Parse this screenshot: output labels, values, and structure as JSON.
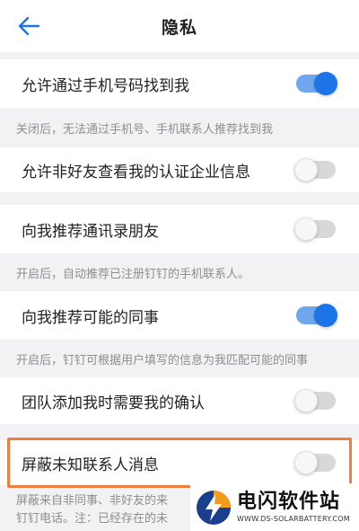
{
  "header": {
    "title": "隐私"
  },
  "settings": [
    {
      "label": "允许通过手机号码找到我",
      "on": true
    },
    {
      "label": "允许非好友查看我的认证企业信息",
      "on": false
    },
    {
      "label": "向我推荐通讯录朋友",
      "on": false
    },
    {
      "label": "向我推荐可能的同事",
      "on": true
    },
    {
      "label": "团队添加我时需要我的确认",
      "on": false
    },
    {
      "label": "屏蔽未知联系人消息",
      "on": false
    }
  ],
  "notes": {
    "phone": "关闭后，无法通过手机号、手机联系人推荐找到我",
    "contacts": "开启后，自动推荐已注册钉钉的手机联系人。",
    "colleagues": "开启后，钉钉可根据用户填写的信息为我匹配可能的同事",
    "block_line1": "屏蔽来自非同事、非好友的来",
    "block_line2": "钉钉电话。注：已经存在的未"
  },
  "watermark": {
    "name": "电闪软件站",
    "url": "WWW.DS-SOLARBATTERY.COM"
  },
  "colors": {
    "accent": "#1d74e6",
    "highlight": "#ef7f3d"
  }
}
